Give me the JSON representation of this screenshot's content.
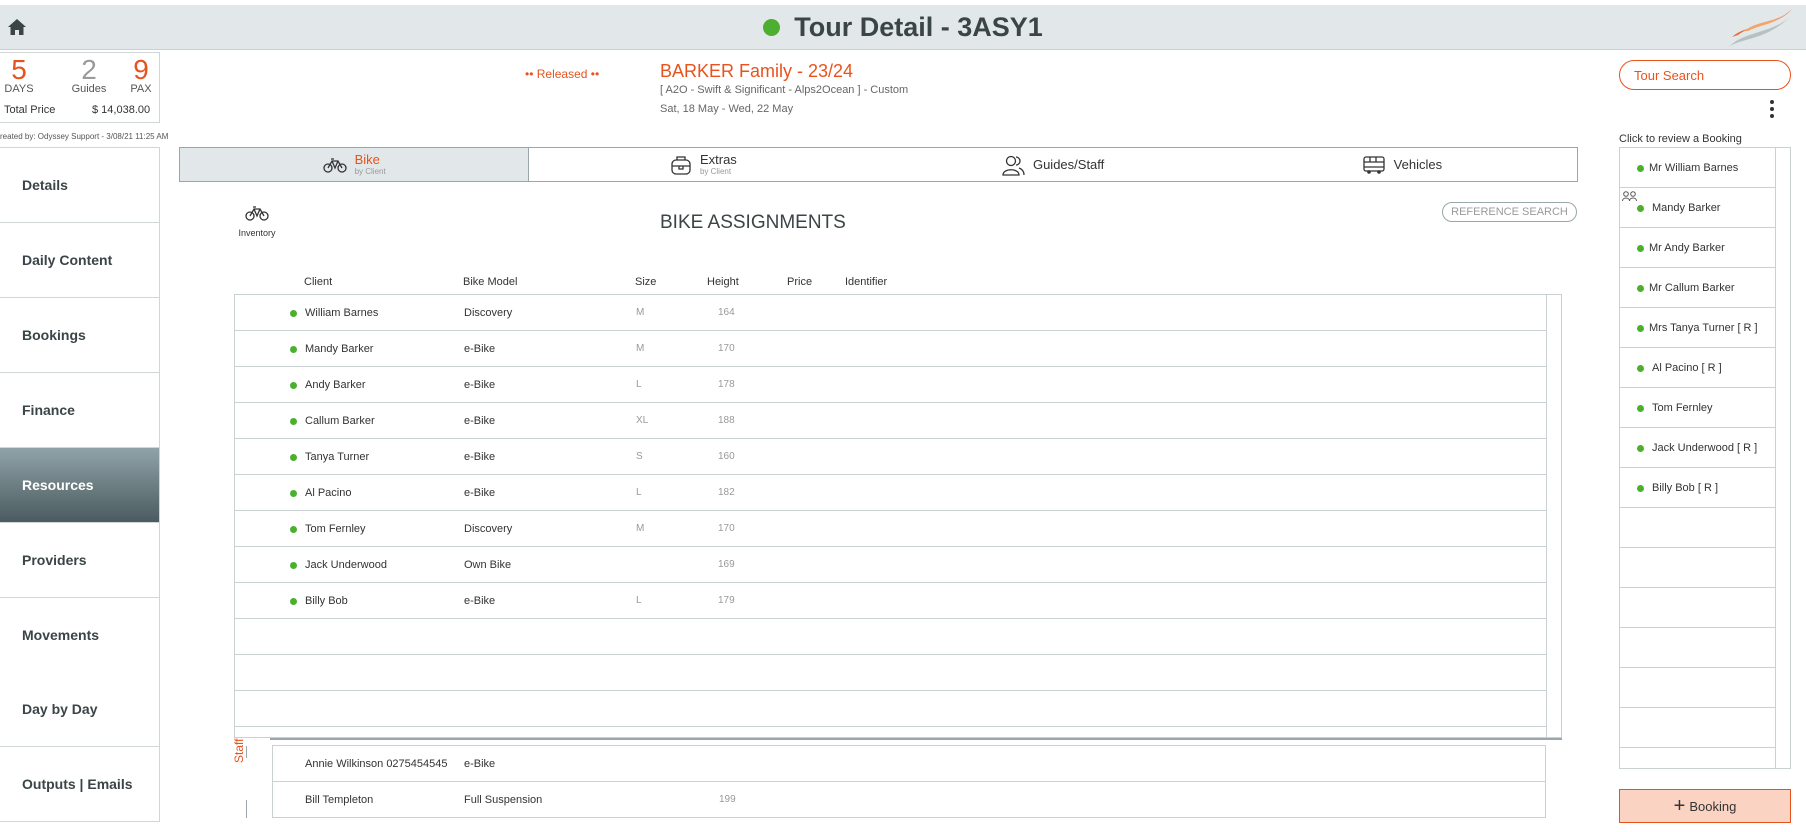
{
  "header": {
    "title": "Tour Detail - 3ASY1",
    "status_color": "#4caf2f",
    "brand_color": "#e8531d"
  },
  "stats": {
    "days_value": "5",
    "days_label": "DAYS",
    "guides_value": "2",
    "guides_label": "Guides",
    "pax_value": "9",
    "pax_label": "PAX",
    "total_label": "Total Price",
    "total_value": "$ 14,038.00",
    "created_by": "reated by: Odyssey Support - 3/08/21 11:25 AM"
  },
  "tour": {
    "status": "•• Released ••",
    "name": "BARKER Family - 23/24",
    "subtitle": "[ A2O - Swift & Significant - Alps2Ocean ] - Custom",
    "dates": "Sat, 18 May  - Wed, 22 May"
  },
  "right": {
    "tour_search_placeholder": "Tour Search",
    "click_review": "Click to review a Booking",
    "add_booking_label": "Booking"
  },
  "nav": {
    "items": [
      {
        "label": "Details"
      },
      {
        "label": "Daily Content"
      },
      {
        "label": "Bookings"
      },
      {
        "label": "Finance"
      },
      {
        "label": "Resources",
        "active": true
      },
      {
        "label": "Providers"
      },
      {
        "label": "Movements"
      },
      {
        "label": "Day by Day"
      },
      {
        "label": "Outputs | Emails"
      }
    ]
  },
  "tabs": [
    {
      "label": "Bike",
      "sub": "by Client",
      "icon": "bike-icon",
      "active": true
    },
    {
      "label": "Extras",
      "sub": "by Client",
      "icon": "bag-icon"
    },
    {
      "label": "Guides/Staff",
      "sub": "",
      "icon": "people-icon"
    },
    {
      "label": "Vehicles",
      "sub": "",
      "icon": "bus-icon"
    }
  ],
  "resources": {
    "inventory_label": "Inventory",
    "heading": "BIKE ASSIGNMENTS",
    "reference_search": "REFERENCE SEARCH",
    "columns": {
      "client": "Client",
      "bike_model": "Bike Model",
      "size": "Size",
      "height": "Height",
      "price": "Price",
      "identifier": "Identifier"
    },
    "rows": [
      {
        "client": "William Barnes",
        "model": "Discovery",
        "size": "M",
        "height": "164"
      },
      {
        "client": "Mandy Barker",
        "model": "e-Bike",
        "size": "M",
        "height": "170"
      },
      {
        "client": "Andy Barker",
        "model": "e-Bike",
        "size": "L",
        "height": "178"
      },
      {
        "client": "Callum Barker",
        "model": "e-Bike",
        "size": "XL",
        "height": "188"
      },
      {
        "client": "Tanya Turner",
        "model": "e-Bike",
        "size": "S",
        "height": "160"
      },
      {
        "client": "Al Pacino",
        "model": "e-Bike",
        "size": "L",
        "height": "182"
      },
      {
        "client": "Tom Fernley",
        "model": "Discovery",
        "size": "M",
        "height": "170"
      },
      {
        "client": "Jack Underwood",
        "model": "Own Bike",
        "size": "",
        "height": "169"
      },
      {
        "client": "Billy Bob",
        "model": "e-Bike",
        "size": "L",
        "height": "179"
      }
    ],
    "staff_label": "Staff",
    "staff_rows": [
      {
        "name": "Annie Wilkinson 0275454545",
        "model": "e-Bike",
        "height": ""
      },
      {
        "name": "Bill Templeton",
        "model": "Full Suspension",
        "height": "199"
      }
    ]
  },
  "bookings": [
    "Mr William Barnes",
    "Mandy Barker",
    "Mr Andy Barker",
    "Mr Callum Barker",
    "Mrs Tanya Turner  [ R ]",
    "Al Pacino  [ R ]",
    "Tom Fernley",
    "Jack Underwood  [ R ]",
    "Billy Bob  [ R ]"
  ]
}
